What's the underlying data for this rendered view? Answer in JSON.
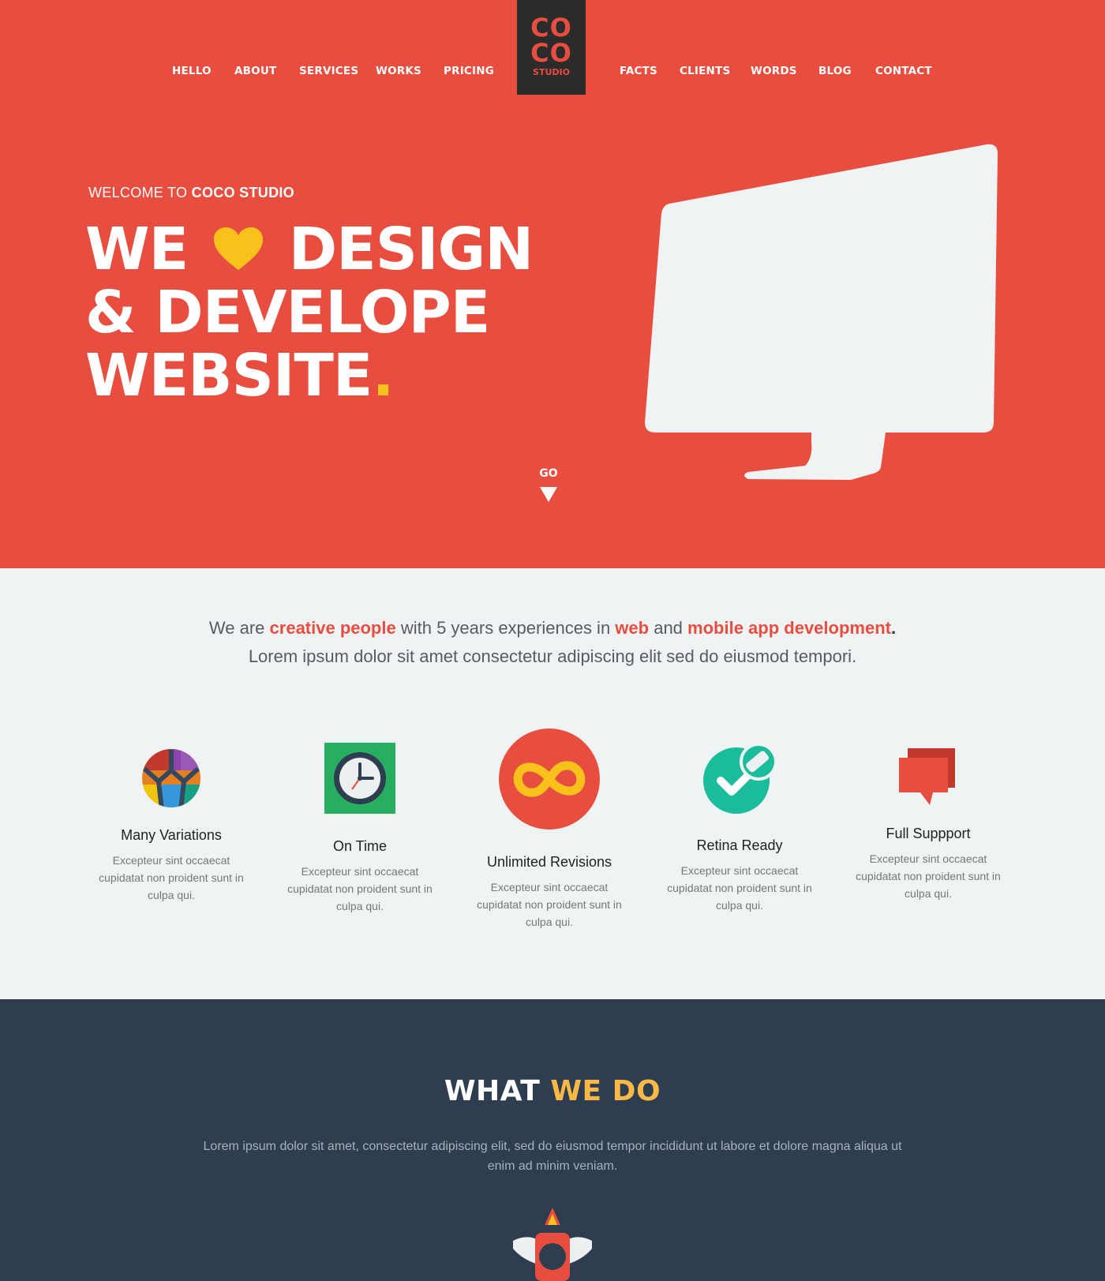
{
  "nav": {
    "logo": {
      "line1": "CO",
      "line2": "CO",
      "line3": "STUDIO"
    },
    "left_items": [
      "HELLO",
      "ABOUT",
      "SERVICES",
      "WORKS",
      "PRICING"
    ],
    "right_items": [
      "FACTS",
      "CLIENTS",
      "WORDS",
      "BLOG",
      "CONTACT"
    ]
  },
  "hero": {
    "welcome_prefix": "WELCOME TO",
    "welcome_brand": "COCO STUDIO",
    "headline_we": "WE",
    "headline_design": "DESIGN",
    "headline_line2": "& DEVELOPE",
    "headline_line3": "WEBSITE",
    "headline_dot": ".",
    "go_label": "GO"
  },
  "intro": {
    "p1_a": "We are ",
    "p1_hl1": "creative people",
    "p1_b": " with 5 years experiences  in ",
    "p1_hl2": "web",
    "p1_c": "  and ",
    "p1_hl3": "mobile app development",
    "p1_d": ".",
    "line2": "Lorem ipsum dolor sit amet consectetur adipiscing elit sed do eiusmod tempori."
  },
  "features": [
    {
      "icon": "palette-globe-icon",
      "title": "Many Variations",
      "text": "Excepteur sint occaecat cupidatat non proident sunt in culpa qui."
    },
    {
      "icon": "clock-icon",
      "title": "On Time",
      "text": "Excepteur sint occaecat cupidatat non proident sunt in culpa qui."
    },
    {
      "icon": "infinity-icon",
      "title": "Unlimited Revisions",
      "text": "Excepteur sint occaecat cupidatat non proident sunt in culpa qui."
    },
    {
      "icon": "check-badge-icon",
      "title": "Retina Ready",
      "text": "Excepteur sint occaecat cupidatat non proident sunt in culpa qui."
    },
    {
      "icon": "chat-bubbles-icon",
      "title": "Full Suppport",
      "text": "Excepteur sint occaecat cupidatat non proident sunt in culpa qui."
    }
  ],
  "what_we_do": {
    "title_a": "WHAT",
    "title_b": "WE DO",
    "text": "Lorem ipsum dolor sit amet, consectetur adipiscing elit, sed do eiusmod tempor incididunt ut labore et dolore magna aliqua ut enim ad minim veniam."
  },
  "colors": {
    "brand_red": "#e84e3f",
    "dark_navy": "#2e3d50",
    "accent_yellow": "#f8c21b",
    "light_bg": "#f0f3f3"
  }
}
